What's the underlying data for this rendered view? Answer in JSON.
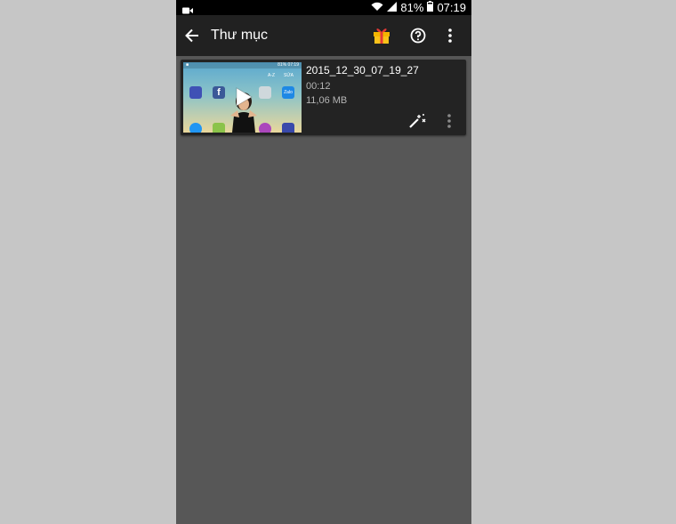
{
  "status_bar": {
    "battery": "81%",
    "time": "07:19",
    "icons": [
      "video-camera-icon",
      "wifi-icon",
      "signal-icon",
      "battery-icon"
    ]
  },
  "app_bar": {
    "title": "Thư mục",
    "icons": [
      "back-arrow-icon",
      "gift-icon",
      "help-icon",
      "more-vert-icon"
    ],
    "gift_colors": {
      "box": "#f4b400",
      "ribbon": "#e53935"
    }
  },
  "video": {
    "filename": "2015_12_30_07_19_27",
    "duration": "00:12",
    "size": "11,06 MB",
    "thumbnail": {
      "status_time": "07:19",
      "status_battery": "81%",
      "sort_label": "A-Z",
      "edit_label": "SỬA"
    }
  },
  "colors": {
    "page_bg": "#c6c6c6",
    "phone_bg": "#575757",
    "app_bar_bg": "#212121",
    "card_bg": "#232323"
  }
}
